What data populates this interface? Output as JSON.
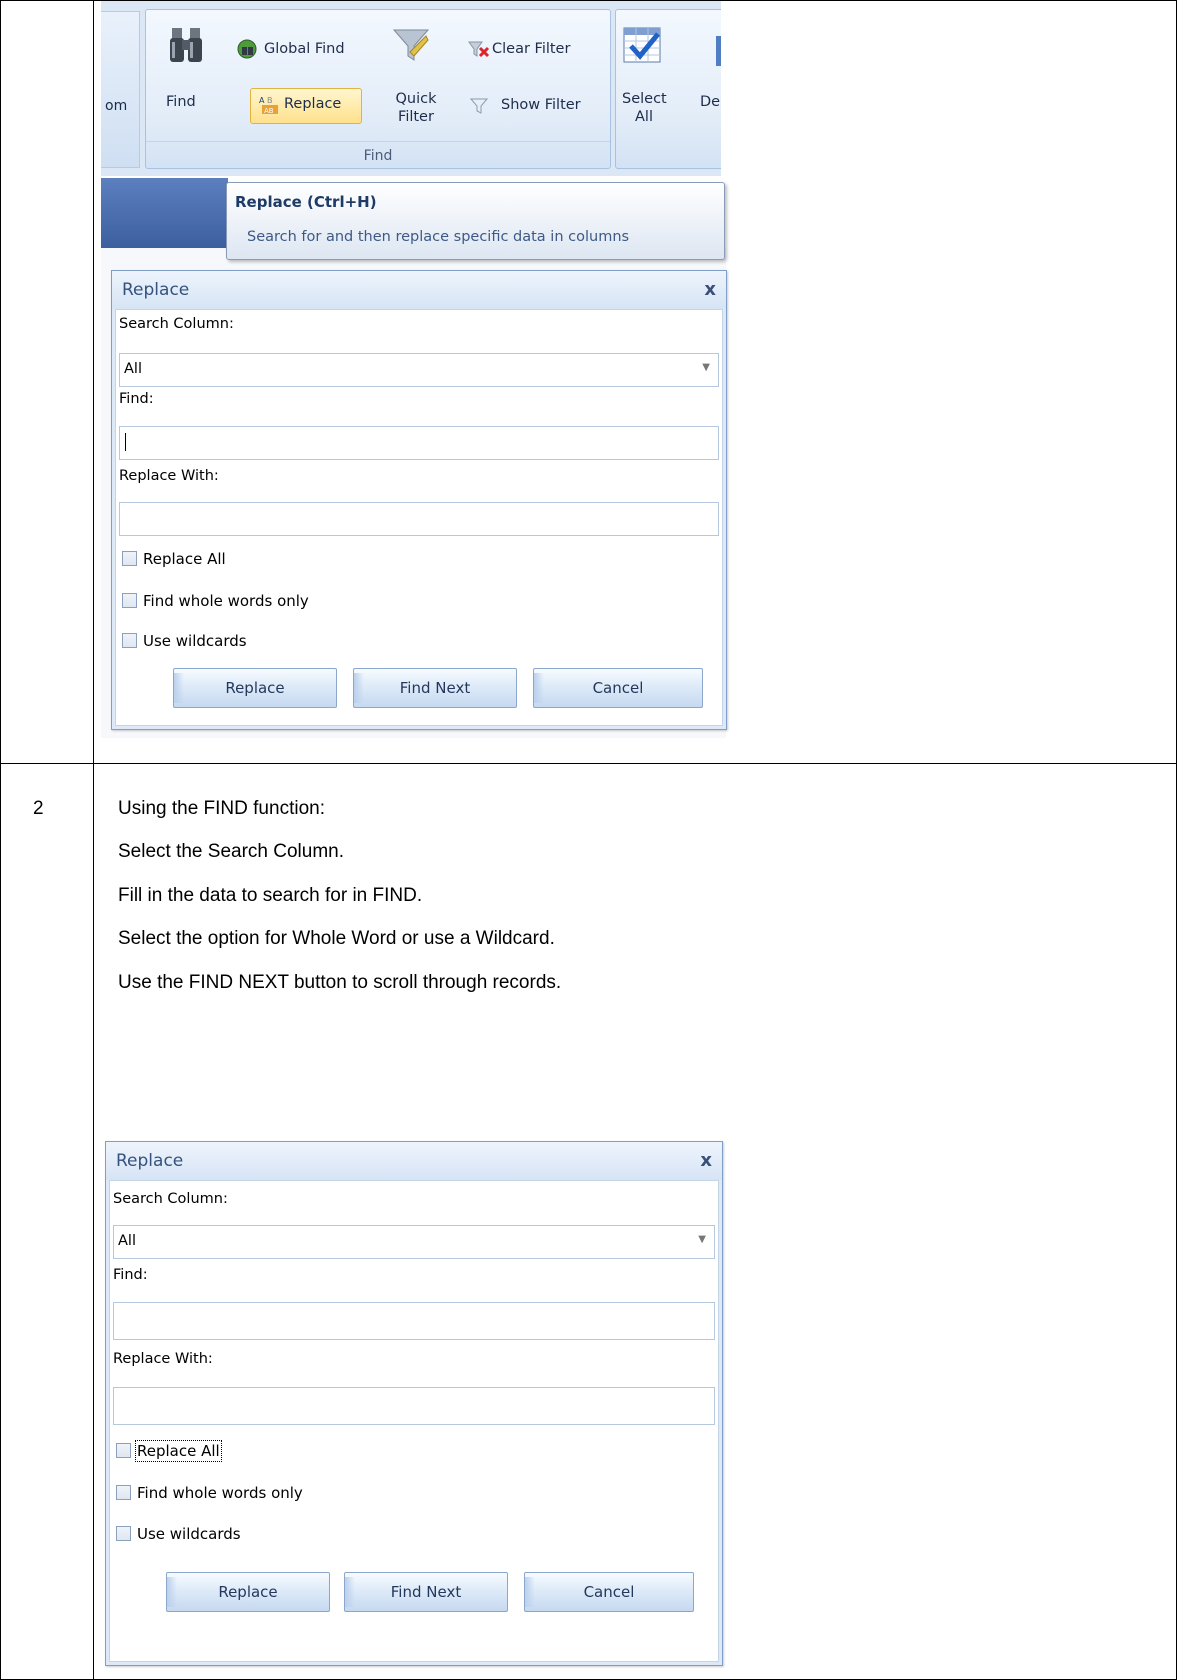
{
  "ribbon": {
    "left_partial_label": "om",
    "group_label": "Find",
    "buttons": {
      "find": "Find",
      "global_find": "Global Find",
      "replace": "Replace",
      "quick_filter": "Quick Filter",
      "clear_filter": "Clear Filter",
      "show_filter": "Show Filter",
      "select_all": "Select All",
      "partial_next": "De"
    }
  },
  "tooltip": {
    "title": "Replace (Ctrl+H)",
    "description": "Search for and then replace specific data in columns"
  },
  "dialog1": {
    "title": "Replace",
    "close": "x",
    "search_column_label": "Search Column:",
    "search_column_value": "All",
    "find_label": "Find:",
    "find_value": "",
    "replace_with_label": "Replace With:",
    "replace_with_value": "",
    "options": [
      "Replace All",
      "Find whole words only",
      "Use wildcards"
    ],
    "buttons": [
      "Replace",
      "Find Next",
      "Cancel"
    ]
  },
  "row2": {
    "number": "2",
    "lines": [
      "Using the FIND function:",
      "Select the Search Column.",
      "Fill in the data to search for in FIND.",
      "Select the option for Whole Word or use a Wildcard.",
      "Use the FIND NEXT button to scroll through records."
    ]
  },
  "dialog2": {
    "title": "Replace",
    "close": "x",
    "search_column_label": "Search Column:",
    "search_column_value": "All",
    "find_label": "Find:",
    "find_value": "",
    "replace_with_label": "Replace With:",
    "replace_with_value": "",
    "options": [
      "Replace All",
      "Find whole words only",
      "Use wildcards"
    ],
    "buttons": [
      "Replace",
      "Find Next",
      "Cancel"
    ]
  }
}
